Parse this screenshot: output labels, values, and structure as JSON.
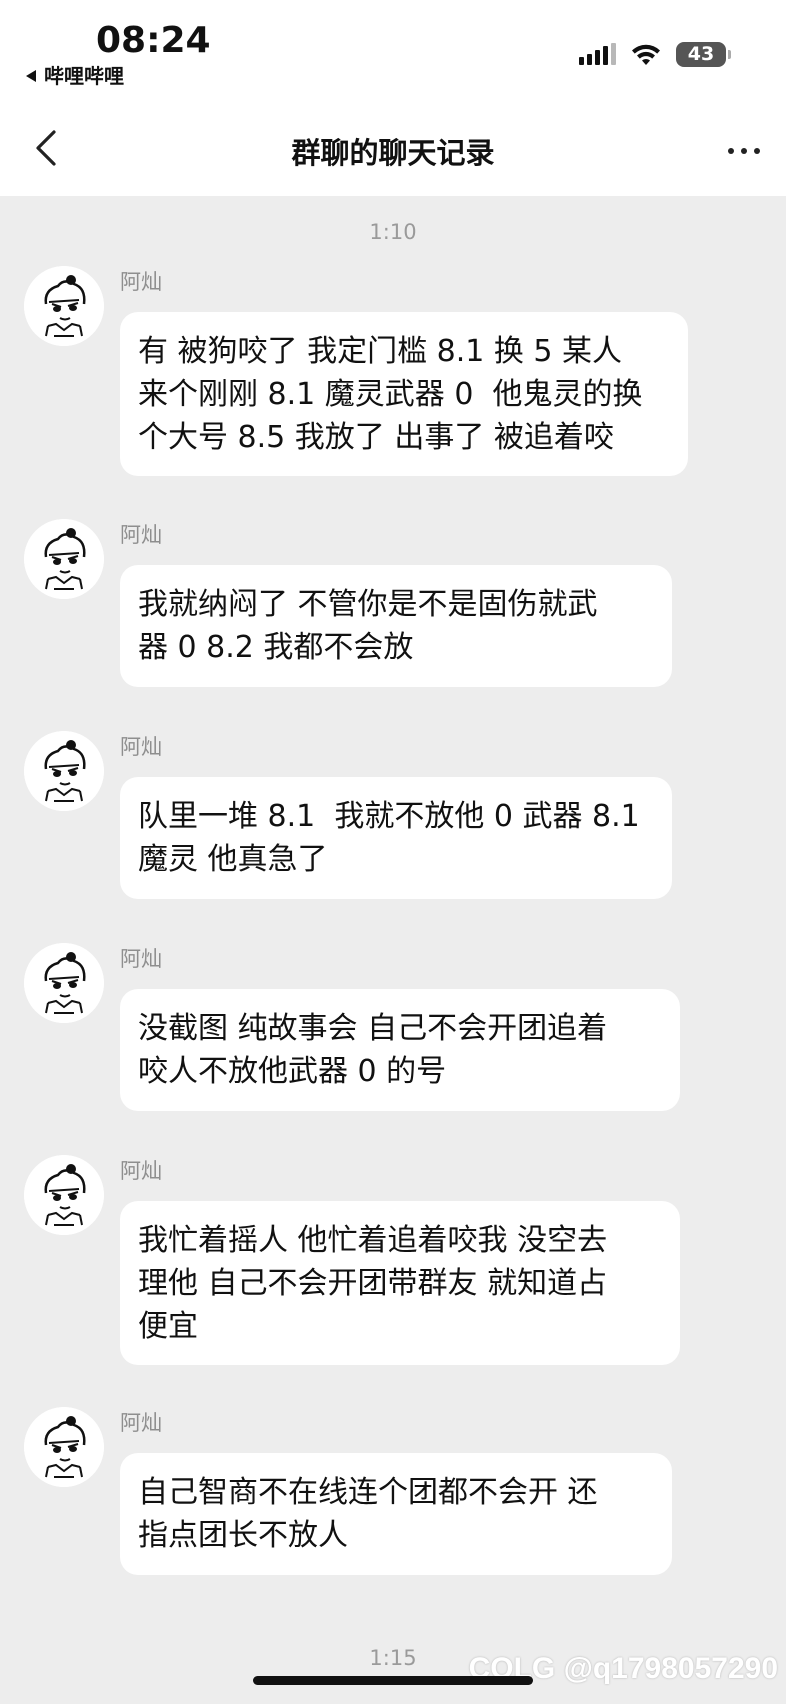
{
  "status_bar": {
    "time": "08:24",
    "back_app": "哔哩哔哩",
    "battery": "43"
  },
  "nav": {
    "title": "群聊的聊天记录"
  },
  "timestamps": [
    "1:10",
    "1:15"
  ],
  "messages": [
    {
      "sender": "阿灿",
      "text": "有 被狗咬了 我定门槛 8.1 换 5 某人\n来个刚刚 8.1 魔灵武器 0  他鬼灵的换\n个大号 8.5 我放了 出事了 被追着咬"
    },
    {
      "sender": "阿灿",
      "text": "我就纳闷了 不管你是不是固伤就武\n器 0 8.2 我都不会放"
    },
    {
      "sender": "阿灿",
      "text": "队里一堆 8.1  我就不放他 0 武器 8.1\n魔灵 他真急了"
    },
    {
      "sender": "阿灿",
      "text": "没截图 纯故事会 自己不会开团追着\n咬人不放他武器 0 的号"
    },
    {
      "sender": "阿灿",
      "text": "我忙着摇人 他忙着追着咬我 没空去\n理他 自己不会开团带群友 就知道占\n便宜"
    },
    {
      "sender": "阿灿",
      "text": "自己智商不在线连个团都不会开 还\n指点团长不放人"
    }
  ],
  "watermark": "COLG @q1798057290"
}
